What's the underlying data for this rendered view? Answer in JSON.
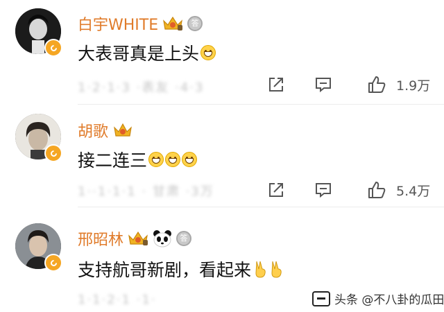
{
  "comments": [
    {
      "user": "白宇WHITE",
      "text": "大表哥真是上头",
      "emojis": [
        "grin-emoji"
      ],
      "meta_blurred": "1·2·1·3 ·表友 ·4·3",
      "likes": "1.9万",
      "badges": [
        "crown-level-9-icon",
        "medal-icon"
      ]
    },
    {
      "user": "胡歌",
      "text": "接二连三",
      "emojis": [
        "grin-emoji",
        "grin-emoji",
        "grin-emoji"
      ],
      "meta_blurred": "1··1·1·1 · 甘肃 ·3万",
      "likes": "5.4万",
      "badges": [
        "crown-icon"
      ]
    },
    {
      "user": "邢昭林",
      "text": "支持航哥新剧，看起来",
      "emojis": [
        "victory-hand-emoji",
        "victory-hand-emoji"
      ],
      "meta_blurred": "1·1·2·1 ·1·",
      "likes": "",
      "badges": [
        "crown-level-icon",
        "panda-icon",
        "medal-icon"
      ]
    }
  ],
  "watermark": "头条 @不八卦的瓜田",
  "colors": {
    "username": "#e07b2a",
    "badge_orange": "#f5a623",
    "divider": "#ececec"
  }
}
